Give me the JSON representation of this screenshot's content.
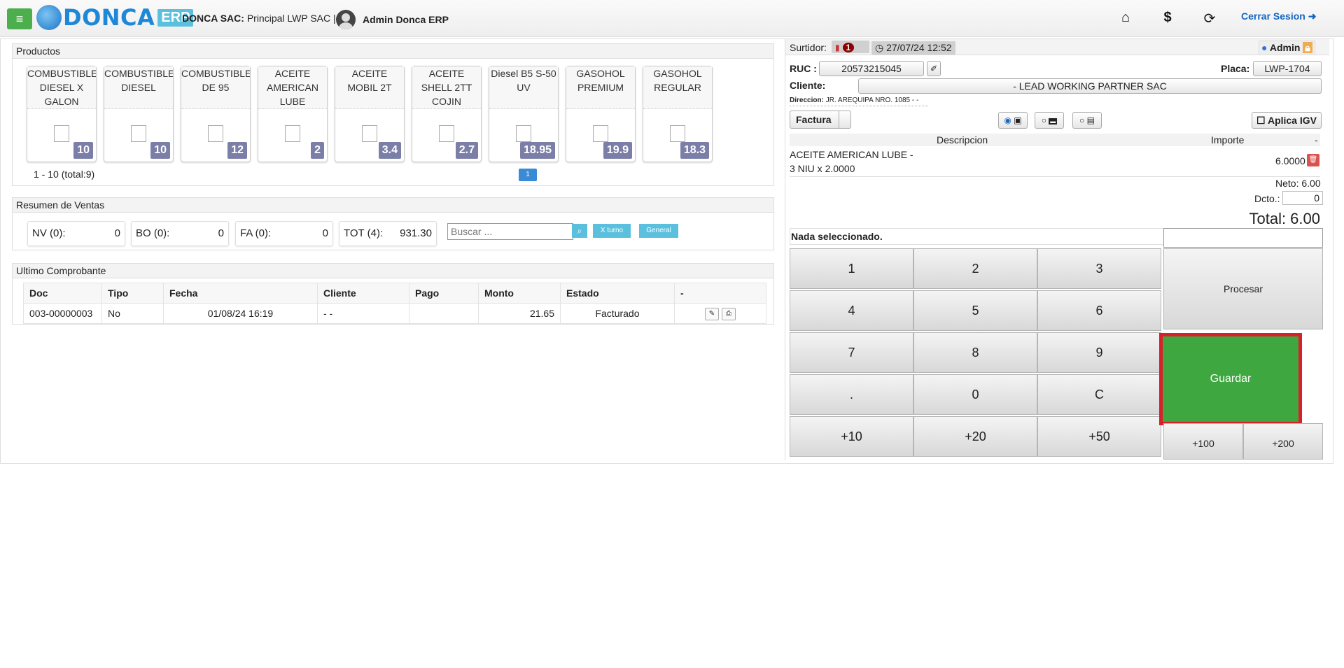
{
  "topbar": {
    "logo_text": "DONCA",
    "logo_erp": "ERP",
    "company_label": "DONCA SAC:",
    "company_branch": "Principal LWP SAC |",
    "user_name": "Admin Donca ERP",
    "logout_label": "Cerrar Sesion",
    "icons": [
      "menu-icon",
      "home-icon",
      "dollar-icon",
      "lock-refresh-icon",
      "logout-icon"
    ]
  },
  "productos": {
    "title": "Productos",
    "items": [
      {
        "name": "COMBUSTIBLE DIESEL X GALON",
        "price": "10"
      },
      {
        "name": "COMBUSTIBLE DIESEL",
        "price": "10"
      },
      {
        "name": "COMBUSTIBLE DE 95",
        "price": "12"
      },
      {
        "name": "ACEITE AMERICAN LUBE",
        "price": "2"
      },
      {
        "name": "ACEITE MOBIL 2T",
        "price": "3.4"
      },
      {
        "name": "ACEITE SHELL 2TT COJIN",
        "price": "2.7"
      },
      {
        "name": "Diesel B5 S-50 UV",
        "price": "18.95"
      },
      {
        "name": "GASOHOL PREMIUM",
        "price": "19.9"
      },
      {
        "name": "GASOHOL REGULAR",
        "price": "18.3"
      }
    ],
    "pager_text": "1 - 10 (total:9)",
    "page": "1"
  },
  "resumen": {
    "title": "Resumen de Ventas",
    "boxes": [
      {
        "label": "NV (0):",
        "value": "0"
      },
      {
        "label": "BO (0):",
        "value": "0"
      },
      {
        "label": "FA (0):",
        "value": "0"
      },
      {
        "label": "TOT (4):",
        "value": "931.30"
      }
    ],
    "search_placeholder": "Buscar ...",
    "btn_turno": "X turno",
    "btn_general": "General"
  },
  "ultimo": {
    "title": "Ultimo Comprobante",
    "headers": [
      "Doc",
      "Tipo",
      "Fecha",
      "Cliente",
      "Pago",
      "Monto",
      "Estado",
      "-"
    ],
    "row": {
      "doc": "003-00000003",
      "tipo": "No",
      "fecha": "01/08/24 16:19",
      "cliente": "- -",
      "pago": "",
      "monto": "21.65",
      "estado": "Facturado"
    }
  },
  "venta": {
    "surtidor_label": "Surtidor:",
    "surtidor_count": "1",
    "datetime": "27/07/24 12:52",
    "admin_label": "Admin",
    "ruc_label": "RUC :",
    "ruc_value": "20573215045",
    "placa_label": "Placa:",
    "placa_value": "LWP-1704",
    "cliente_label": "Cliente:",
    "cliente_value": "- LEAD WORKING PARTNER SAC",
    "direccion_label": "Direccion:",
    "direccion_value": "JR. AREQUIPA NRO. 1085 - -",
    "doc_type": "Factura",
    "aplica_igv": "Aplica IGV",
    "col_desc": "Descripcion",
    "col_importe": "Importe",
    "col_dash": "-",
    "item_line1": "ACEITE AMERICAN LUBE -",
    "item_line2": "3 NIU x 2.0000",
    "item_importe": "6.0000",
    "neto": "Neto: 6.00",
    "dcto_label": "Dcto.:",
    "dcto_value": "0",
    "total": "Total: 6.00",
    "nada": "Nada seleccionado."
  },
  "keypad": {
    "keys": [
      "1",
      "2",
      "3",
      "4",
      "5",
      "6",
      "7",
      "8",
      "9",
      ".",
      "0",
      "C",
      "+10",
      "+20",
      "+50"
    ],
    "plus100": "+100",
    "plus200": "+200",
    "procesar": "Procesar",
    "guardar": "Guardar"
  }
}
